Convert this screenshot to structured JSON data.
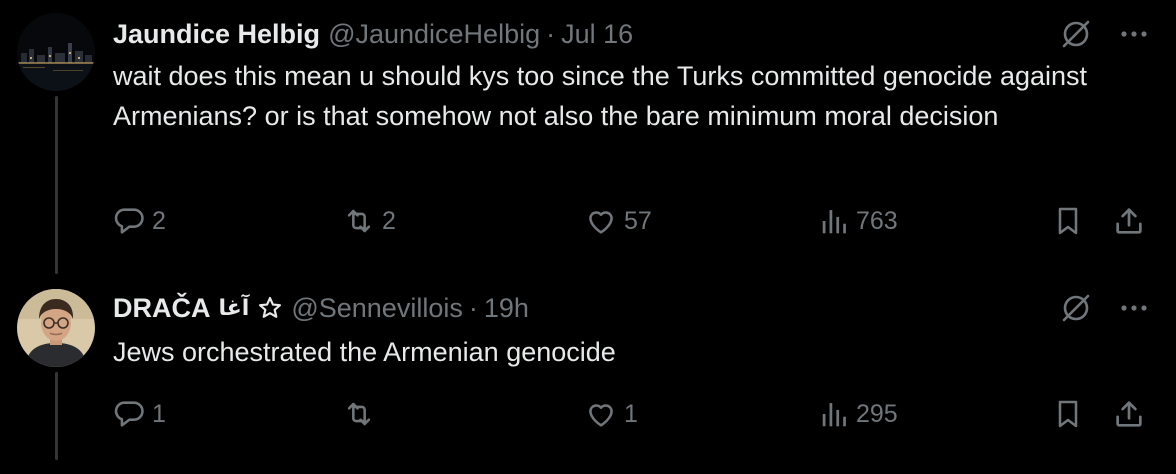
{
  "colors": {
    "background": "#000000",
    "text_primary": "#e7e9ea",
    "text_secondary": "#71767b",
    "thread_line": "#333639"
  },
  "tweets": [
    {
      "display_name": "Jaundice Helbig",
      "handle": "@JaundiceHelbig",
      "separator": "·",
      "time": "Jul 16",
      "text": "wait does this mean u should kys too since the Turks committed genocide against Armenians? or is that somehow not also the bare minimum moral decision",
      "avatar_icon": "city-night-skyline",
      "actions": {
        "replies": "2",
        "reposts": "2",
        "likes": "57",
        "views": "763"
      }
    },
    {
      "display_name": "DRAČA",
      "name_suffix": "آغا",
      "name_badge_icon": "star-outline-icon",
      "handle": "@Sennevillois",
      "separator": "·",
      "time": "19h",
      "text": "Jews orchestrated the Armenian genocide",
      "avatar_icon": "person-with-glasses",
      "actions": {
        "replies": "1",
        "reposts": "",
        "likes": "1",
        "views": "295"
      }
    }
  ]
}
